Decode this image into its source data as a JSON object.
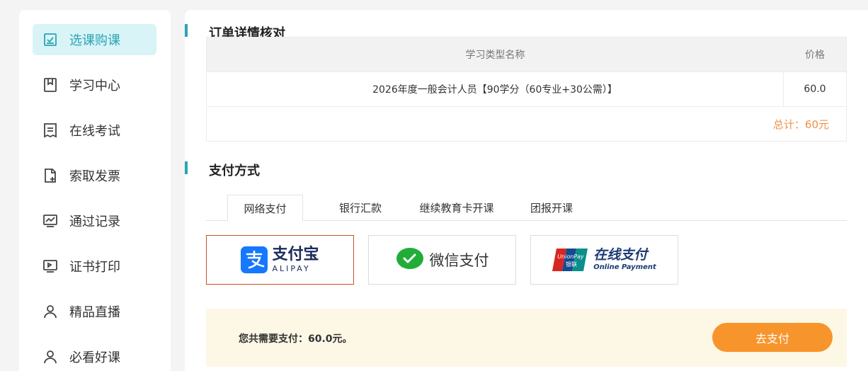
{
  "sidebar": {
    "items": [
      {
        "label": "选课购课",
        "icon": "checkbox-icon",
        "active": true
      },
      {
        "label": "学习中心",
        "icon": "bookmark-icon"
      },
      {
        "label": "在线考试",
        "icon": "receipt-icon"
      },
      {
        "label": "索取发票",
        "icon": "file-add-icon"
      },
      {
        "label": "通过记录",
        "icon": "chart-icon"
      },
      {
        "label": "证书打印",
        "icon": "monitor-icon"
      },
      {
        "label": "精品直播",
        "icon": "user-icon"
      },
      {
        "label": "必看好课",
        "icon": "user-icon"
      }
    ]
  },
  "order": {
    "title": "订单详情核对",
    "header_name": "学习类型名称",
    "header_price": "价格",
    "row_name": "2026年度一般会计人员【90学分（60专业+30公需）】",
    "row_price": "60.0",
    "total": "总计：60元"
  },
  "payment": {
    "title": "支付方式",
    "tabs": [
      "网络支付",
      "银行汇款",
      "继续教育卡开课",
      "团报开课"
    ],
    "options": {
      "alipay_main": "支付宝",
      "alipay_sub": "ALIPAY",
      "wechat": "微信支付",
      "unionpay_main": "在线支付",
      "unionpay_sub": "Online Payment",
      "unionpay_badge_en": "UnionPay",
      "unionpay_badge_cn": "银联"
    },
    "summary": "您共需要支付：60.0元。",
    "button": "去支付"
  },
  "colors": {
    "accent": "#2aa4b4",
    "pay_button": "#f7952c",
    "total_text": "#f0914a",
    "selected_border": "#c9502c"
  }
}
